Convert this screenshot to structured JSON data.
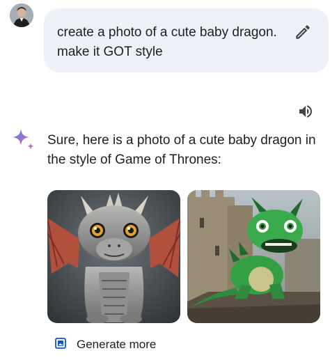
{
  "user": {
    "prompt": "create a photo of a cute baby dragon. make it GOT style"
  },
  "response": {
    "text": "Sure, here is a photo of a cute baby dragon in the style of Game of Thrones:",
    "images": [
      {
        "subject": "grey baby dragon with red wings"
      },
      {
        "subject": "green baby dragon on castle wall"
      }
    ],
    "generate_more_label": "Generate more"
  },
  "icons": {
    "edit": "pencil-icon",
    "speaker": "speaker-icon",
    "assistant": "sparkle-icon",
    "generate_more": "gallery-icon"
  },
  "colors": {
    "prompt_bubble": "#eef1f7",
    "sparkle_blue": "#4285f4",
    "sparkle_purple": "#9b72cb",
    "sparkle_red": "#d96570"
  }
}
